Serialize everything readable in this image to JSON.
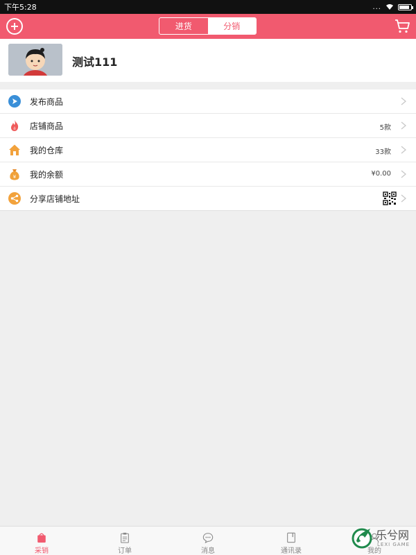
{
  "status_bar": {
    "time": "下午5:28",
    "dots": "..."
  },
  "colors": {
    "accent": "#f15a6f",
    "background": "#efefef"
  },
  "header": {
    "tabs": [
      {
        "label": "进货",
        "active": false
      },
      {
        "label": "分销",
        "active": true
      }
    ],
    "left_icon": "add-icon",
    "right_icon": "cart-icon"
  },
  "profile": {
    "name": "测试111"
  },
  "menu": {
    "items": [
      {
        "label": "发布商品",
        "value": "",
        "icon": "publish-icon"
      },
      {
        "label": "店铺商品",
        "value": "5款",
        "icon": "flame-icon"
      },
      {
        "label": "我的仓库",
        "value": "33款",
        "icon": "house-icon"
      },
      {
        "label": "我的余额",
        "value": "¥0.00",
        "icon": "money-bag-icon"
      },
      {
        "label": "分享店铺地址",
        "value": "",
        "icon": "share-icon"
      }
    ]
  },
  "bottom_nav": {
    "tabs": [
      {
        "label": "采销",
        "active": true
      },
      {
        "label": "订单",
        "active": false
      },
      {
        "label": "消息",
        "active": false
      },
      {
        "label": "通讯录",
        "active": false
      },
      {
        "label": "我的",
        "active": false
      }
    ]
  },
  "watermark": {
    "text": "乐兮网",
    "sub": "LEXI GAME"
  }
}
